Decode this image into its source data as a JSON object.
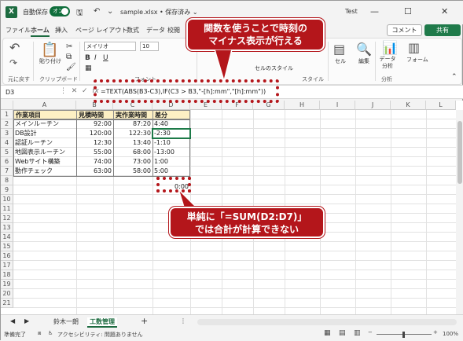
{
  "titlebar": {
    "logo": "X",
    "autosave_label": "自動保存",
    "autosave_state": "オン",
    "filename": "sample.xlsx • 保存済み ⌄",
    "user": "Test"
  },
  "tabs": [
    "ファイル",
    "ホーム",
    "挿入",
    "ページ レイアウト",
    "数式",
    "データ",
    "校閲"
  ],
  "active_tab": "ホーム",
  "actions": {
    "comment": "コメント",
    "share": "共有"
  },
  "ribbon": {
    "undo_label": "元に戻す",
    "clipboard_label": "クリップボード",
    "paste_label": "貼り付け",
    "font_name": "メイリオ",
    "font_size": "10",
    "font_label": "フォント",
    "cell_style": "セルのスタイル",
    "style_label": "スタイル",
    "cells": "セル",
    "editing": "編集",
    "analyze": "データ分析",
    "analysis_label": "分析",
    "forms": "フォーム"
  },
  "formula_bar": {
    "name_box": "D3",
    "formula": "=TEXT(ABS(B3-C3),IF(C3 > B3,\"-[h]:mm\",\"[h]:mm\"))"
  },
  "columns": [
    "A",
    "B",
    "C",
    "D",
    "E",
    "F",
    "G",
    "H",
    "I",
    "J",
    "K",
    "L"
  ],
  "rows": [
    "1",
    "2",
    "3",
    "4",
    "5",
    "6",
    "7",
    "8",
    "9",
    "10",
    "11",
    "12",
    "13",
    "14",
    "15",
    "16",
    "17",
    "18",
    "19",
    "20",
    "21"
  ],
  "table": {
    "headers": [
      "作業項目",
      "見積時間",
      "実作業時間",
      "差分"
    ],
    "rows": [
      [
        "メインルーチン",
        "92:00",
        "87:20",
        "4:40"
      ],
      [
        "DB設計",
        "120:00",
        "122:30",
        "-2:30"
      ],
      [
        "認証ルーチン",
        "12:30",
        "13:40",
        "-1:10"
      ],
      [
        "地図表示ルーチン",
        "55:00",
        "68:00",
        "-13:00"
      ],
      [
        "Webサイト構築",
        "74:00",
        "73:00",
        "1:00"
      ],
      [
        "動作チェック",
        "63:00",
        "58:00",
        "5:00"
      ]
    ],
    "sum_cell": "0:00"
  },
  "sheets": [
    "鈴木一朗",
    "工数管理"
  ],
  "active_sheet": "工数管理",
  "status": {
    "ready": "準備完了",
    "accessibility": "アクセシビリティ: 問題ありません",
    "zoom": "100%"
  },
  "callouts": {
    "top_line1": "関数を使うことで時刻の",
    "top_line2": "マイナス表示が行える",
    "bottom_line1": "単純に「=SUM(D2:D7)」",
    "bottom_line2": "では合計が計算できない"
  },
  "colors": {
    "accent": "#1d6b40",
    "callout": "#b4161b",
    "header_fill": "#fdf0c4"
  }
}
